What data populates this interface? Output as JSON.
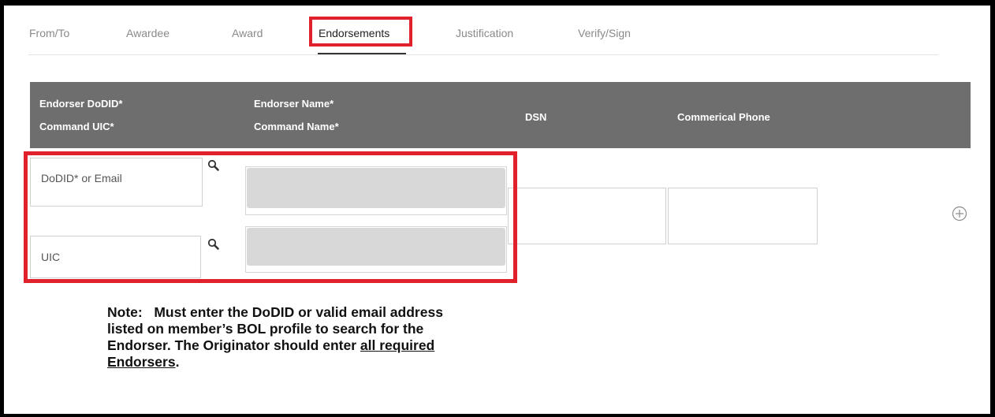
{
  "tabs": [
    {
      "label": "From/To",
      "active": false
    },
    {
      "label": "Awardee",
      "active": false
    },
    {
      "label": "Award",
      "active": false
    },
    {
      "label": "Endorsements",
      "active": true
    },
    {
      "label": "Justification",
      "active": false
    },
    {
      "label": "Verify/Sign",
      "active": false
    }
  ],
  "header": {
    "col1_line1": "Endorser DoDID*",
    "col1_line2": "Command UIC*",
    "col2_line1": "Endorser Name*",
    "col2_line2": "Command Name*",
    "col3": "DSN",
    "col4": "Commerical Phone"
  },
  "row": {
    "dodid_placeholder": "DoDID* or Email",
    "uic_placeholder": "UIC",
    "endorser_name_value": "",
    "command_name_value": "",
    "dsn_value": "",
    "phone_value": ""
  },
  "note": {
    "lead": "Note:",
    "text": "Must enter the DoDID or valid email address listed on member’s BOL profile to search for the Endorser. The Originator should enter",
    "underlined": "all required Endorsers",
    "end": "."
  },
  "colors": {
    "highlight": "#e0202a",
    "header_bg": "#6e6e6e"
  }
}
